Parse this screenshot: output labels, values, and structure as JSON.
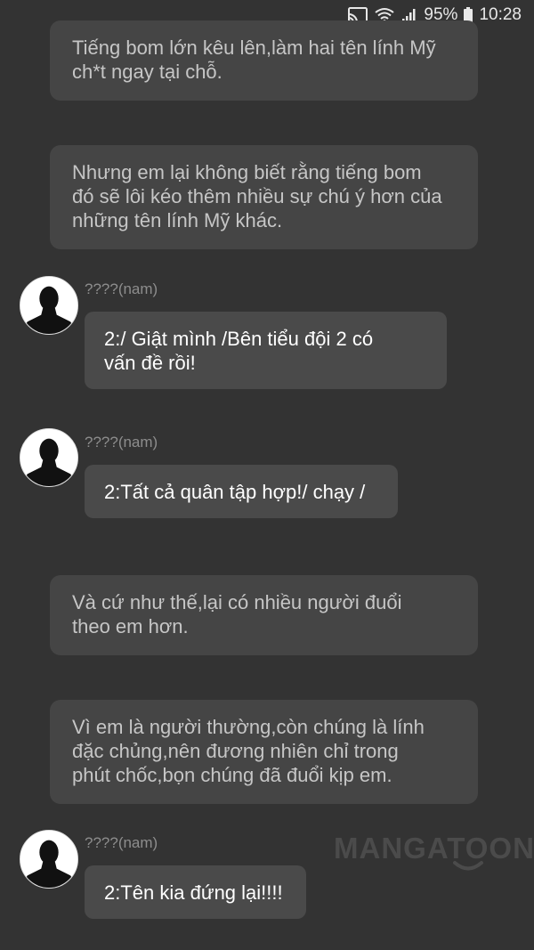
{
  "status_bar": {
    "battery_text": "95%",
    "time": "10:28",
    "icons": [
      "cast-icon",
      "wifi-icon",
      "signal-icon",
      "battery-icon"
    ]
  },
  "messages": [
    {
      "type": "narration",
      "lines": [
        "Tiếng bom lớn kêu lên,làm hai tên lính Mỹ",
        "ch*t ngay tại chỗ."
      ]
    },
    {
      "type": "narration",
      "lines": [
        "Nhưng em lại không biết rằng tiếng bom",
        "đó sẽ lôi kéo thêm nhiều sự chú ý hơn của",
        "những tên lính Mỹ khác."
      ]
    },
    {
      "type": "dialogue",
      "speaker": "????(nam)",
      "lines": [
        "2:/ Giật mình /Bên tiểu đội 2 có",
        "vấn đề rồi!"
      ]
    },
    {
      "type": "dialogue",
      "speaker": "????(nam)",
      "lines": [
        "2:Tất cả quân tập hợp!/ chạy /"
      ]
    },
    {
      "type": "narration",
      "lines": [
        "Và cứ như thế,lại có nhiều người đuổi",
        "theo em hơn."
      ]
    },
    {
      "type": "narration",
      "lines": [
        "Vì em là người thường,còn chúng là lính",
        "đặc chủng,nên đương nhiên chỉ trong",
        "phút chốc,bọn chúng đã đuổi kịp em."
      ]
    },
    {
      "type": "dialogue",
      "speaker": "????(nam)",
      "lines": [
        "2:Tên kia đứng lại!!!!"
      ]
    }
  ],
  "watermark": "MANGATOON",
  "colors": {
    "background": "#333333",
    "narration_bubble": "#454545",
    "dialogue_bubble": "#4a4a4a",
    "narration_text": "#c6c6c6",
    "dialogue_text": "#ffffff",
    "speaker_text": "#8d8d8d"
  }
}
